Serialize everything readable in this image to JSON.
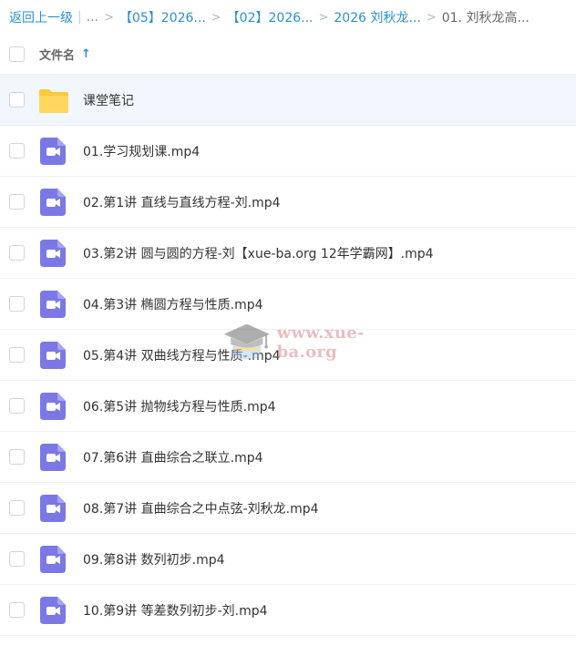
{
  "breadcrumb": {
    "back_label": "返回上一级",
    "pipe": "|",
    "ellipsis": "...",
    "separator": ">",
    "items": [
      {
        "label": "【05】2026..."
      },
      {
        "label": "【02】2026..."
      },
      {
        "label": "2026 刘秋龙..."
      }
    ],
    "current": "01. 刘秋龙高..."
  },
  "header": {
    "column_label": "文件名",
    "sort_arrow": "↑"
  },
  "files": [
    {
      "name": "课堂笔记",
      "type": "folder-icon"
    },
    {
      "name": "01.学习规划课.mp4",
      "type": "video-file-icon"
    },
    {
      "name": "02.第1讲 直线与直线方程-刘.mp4",
      "type": "video-file-icon"
    },
    {
      "name": "03.第2讲 圆与圆的方程-刘【xue-ba.org 12年学霸网】.mp4",
      "type": "video-file-icon"
    },
    {
      "name": "04.第3讲 椭圆方程与性质.mp4",
      "type": "video-file-icon"
    },
    {
      "name": "05.第4讲 双曲线方程与性质-.mp4",
      "type": "video-file-icon"
    },
    {
      "name": "06.第5讲 抛物线方程与性质.mp4",
      "type": "video-file-icon"
    },
    {
      "name": "07.第6讲 直曲综合之联立.mp4",
      "type": "video-file-icon"
    },
    {
      "name": "08.第7讲 直曲综合之中点弦-刘秋龙.mp4",
      "type": "video-file-icon"
    },
    {
      "name": "09.第8讲 数列初步.mp4",
      "type": "video-file-icon"
    },
    {
      "name": "10.第9讲 等差数列初步-刘.mp4",
      "type": "video-file-icon"
    }
  ],
  "watermark": {
    "text": "www.xue-ba.org",
    "icon": "graduation-cap-icon"
  },
  "colors": {
    "link": "#2a8fd6",
    "folder": "#ffcf4d",
    "video": "#7b78e6",
    "selected_row": "#f1f7fd"
  }
}
